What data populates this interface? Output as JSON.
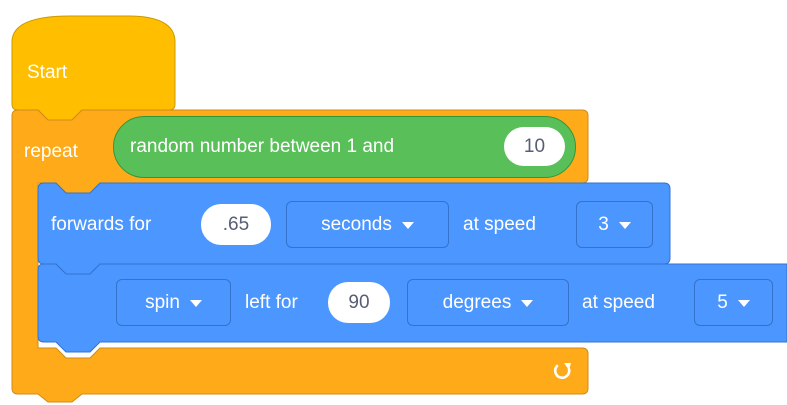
{
  "colors": {
    "events": "#ffbf00",
    "control": "#ffab19",
    "motion": "#4c97ff",
    "operators": "#59c059",
    "input_text": "#575e75"
  },
  "start_block": {
    "label": "Start"
  },
  "repeat_block": {
    "label": "repeat",
    "loop_icon": "loop-arrow-icon"
  },
  "random_reporter": {
    "label": "random number between 1 and",
    "value": "10"
  },
  "forwards_block": {
    "label": "forwards for",
    "duration": ".65",
    "unit": "seconds",
    "speed_label": "at speed",
    "speed": "3"
  },
  "spin_block": {
    "mode": "spin",
    "direction_label": "left for",
    "amount": "90",
    "unit": "degrees",
    "speed_label": "at speed",
    "speed": "5"
  }
}
